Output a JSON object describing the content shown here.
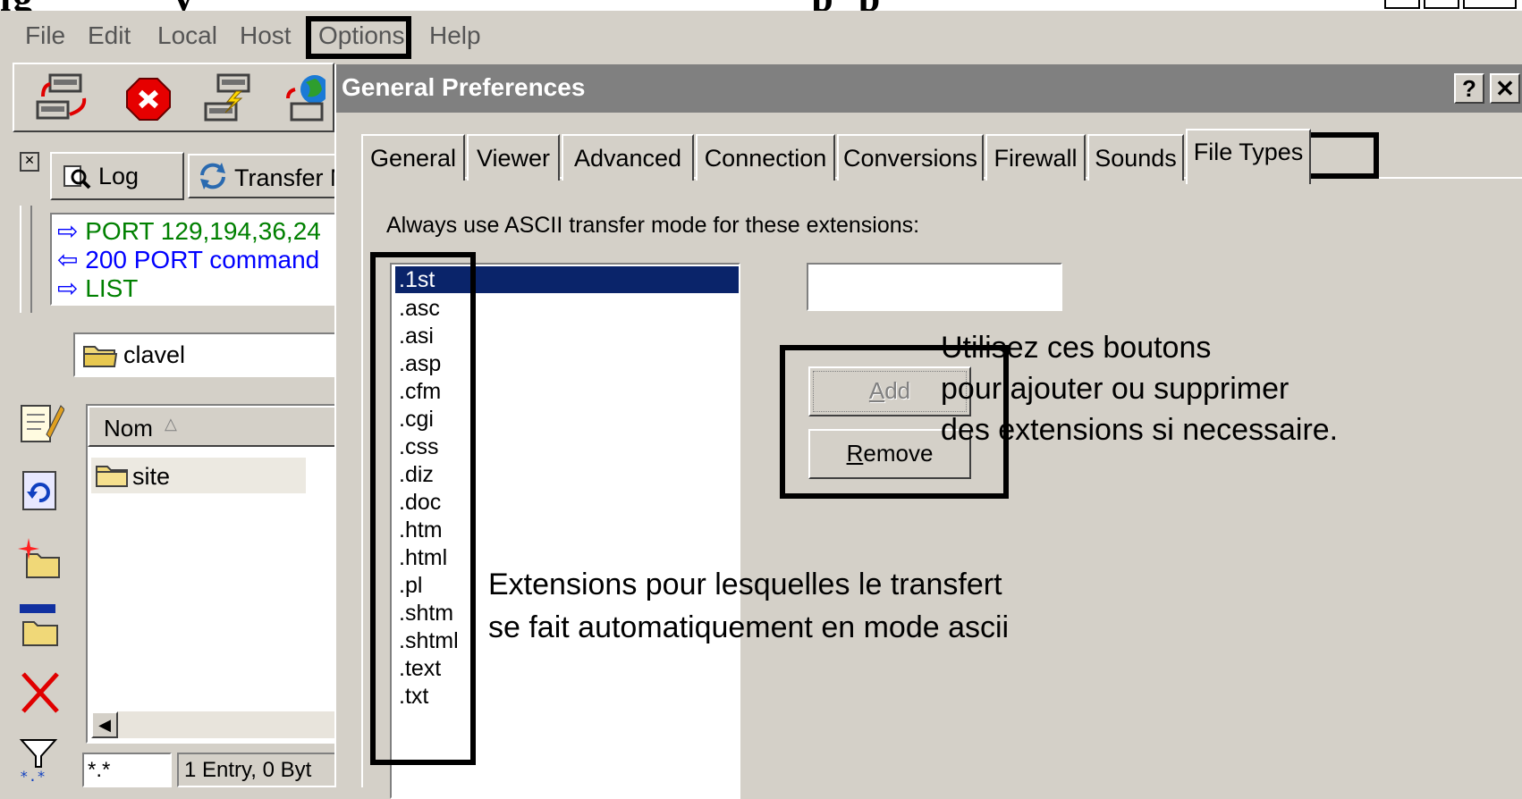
{
  "menubar": {
    "items": [
      "File",
      "Edit",
      "Local",
      "Host",
      "Options",
      "Help"
    ]
  },
  "log_tabs": {
    "log": "Log",
    "transfer": "Transfer M"
  },
  "log_lines": [
    {
      "text": "PORT 129,194,36,24",
      "color": "#008000"
    },
    {
      "text": "200 PORT command",
      "color": "#0000ff"
    },
    {
      "text": "LIST",
      "color": "#008000"
    }
  ],
  "local_path": "clavel",
  "file_list": {
    "column": "Nom",
    "items": [
      "site"
    ]
  },
  "status": {
    "filter": "*.*",
    "entries": "1 Entry, 0 Byt"
  },
  "dialog": {
    "title": "General Preferences",
    "help_button": "?",
    "close_button": "✕",
    "tabs": [
      "General",
      "Viewer",
      "Advanced",
      "Connection",
      "Conversions",
      "Firewall",
      "Sounds",
      "File Types"
    ],
    "active_tab": "File Types",
    "ascii_label": "Always use ASCII transfer mode for these extensions:",
    "extensions": [
      ".1st",
      ".asc",
      ".asi",
      ".asp",
      ".cfm",
      ".cgi",
      ".css",
      ".diz",
      ".doc",
      ".htm",
      ".html",
      ".pl",
      ".shtm",
      ".shtml",
      ".text",
      ".txt"
    ],
    "selected_extension": ".1st",
    "new_extension_value": "",
    "add_button": "Add",
    "remove_button": "Remove"
  },
  "annotations": {
    "buttons_note": [
      "Utilisez ces boutons",
      "pour ajouter ou supprimer",
      "des extensions si necessaire."
    ],
    "list_note": [
      "Extensions pour lesquelles le transfert",
      "se fait automatiquement en mode ascii"
    ]
  },
  "colors": {
    "selection": "#0a246a",
    "titlebar_inactive": "#808080",
    "face": "#d4d0c8"
  }
}
